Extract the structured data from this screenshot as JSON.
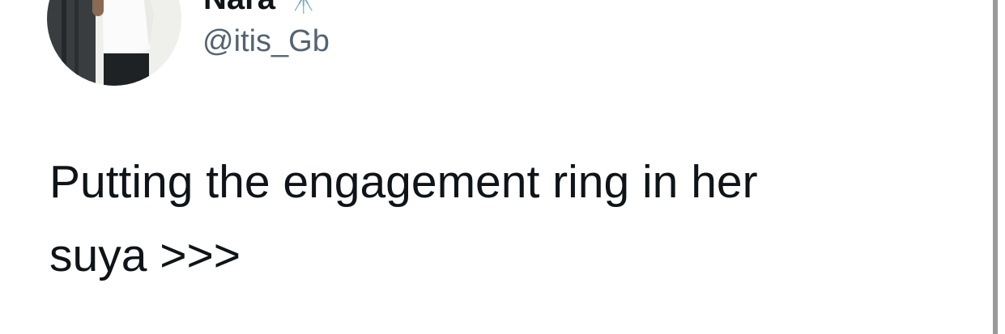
{
  "tweet": {
    "author": {
      "display_name": "Nara",
      "name_emoji": "🔭",
      "handle": "@itis_Gb"
    },
    "text_lines": [
      "Putting the engagement ring in her",
      "suya >>>"
    ]
  },
  "icons": {
    "avatar": "profile-photo"
  }
}
